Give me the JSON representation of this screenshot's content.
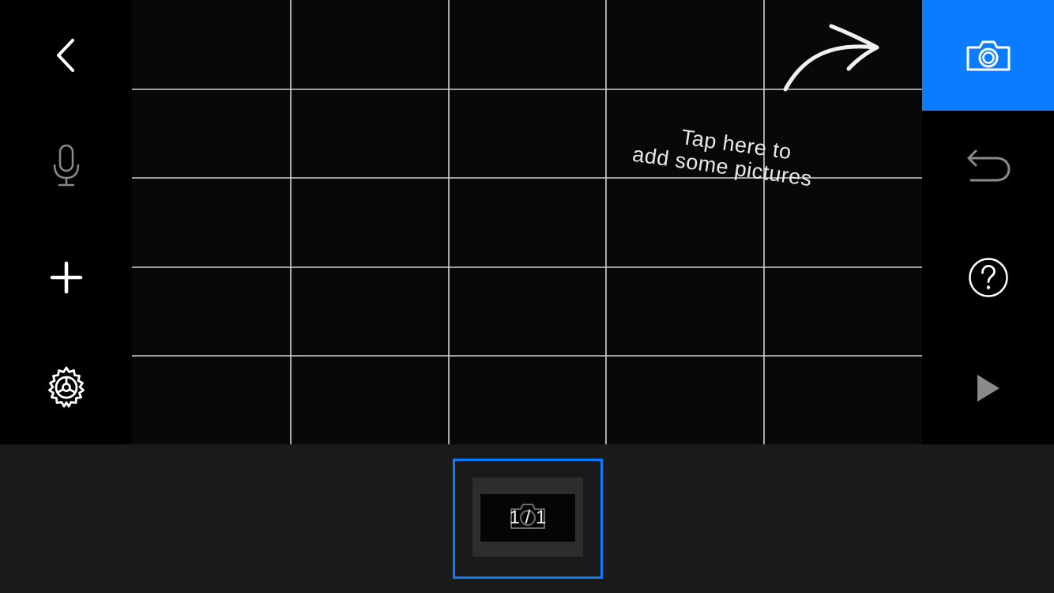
{
  "colors": {
    "accent": "#0a7cff",
    "background": "#000000",
    "filmstrip_background": "#1a1a1a",
    "grid_lines": "#e6e6e6",
    "disabled_icon": "#8a8a8a"
  },
  "left_toolbar": {
    "items": [
      {
        "name": "back",
        "icon": "chevron-left-icon",
        "enabled": true
      },
      {
        "name": "record-audio",
        "icon": "microphone-icon",
        "enabled": false
      },
      {
        "name": "add",
        "icon": "plus-icon",
        "enabled": true
      },
      {
        "name": "settings",
        "icon": "gear-icon",
        "enabled": true
      }
    ]
  },
  "right_toolbar": {
    "items": [
      {
        "name": "capture",
        "icon": "camera-icon",
        "active": true
      },
      {
        "name": "undo",
        "icon": "undo-icon",
        "enabled": false
      },
      {
        "name": "help",
        "icon": "help-icon",
        "enabled": true
      },
      {
        "name": "play",
        "icon": "play-icon",
        "enabled": false
      }
    ]
  },
  "viewfinder": {
    "grid": {
      "columns": 5,
      "rows": 5
    },
    "hint": {
      "line1": "Tap here to",
      "line2": "add some pictures",
      "icon": "curved-arrow-icon"
    }
  },
  "filmstrip": {
    "frame_counter": "1 / 1",
    "frame_icon": "camera-icon",
    "selected": true
  }
}
